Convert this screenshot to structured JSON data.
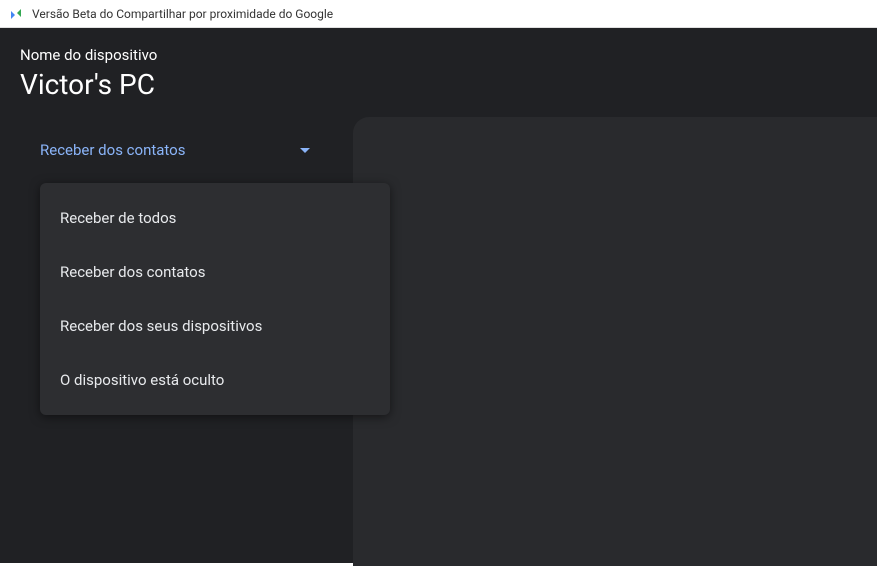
{
  "window": {
    "title": "Versão Beta do Compartilhar por proximidade do Google"
  },
  "header": {
    "device_label": "Nome do dispositivo",
    "device_name": "Victor's PC"
  },
  "visibility": {
    "selected": "Receber dos contatos",
    "options": [
      "Receber de todos",
      "Receber dos contatos",
      "Receber dos seus dispositivos",
      "O dispositivo está oculto"
    ]
  }
}
